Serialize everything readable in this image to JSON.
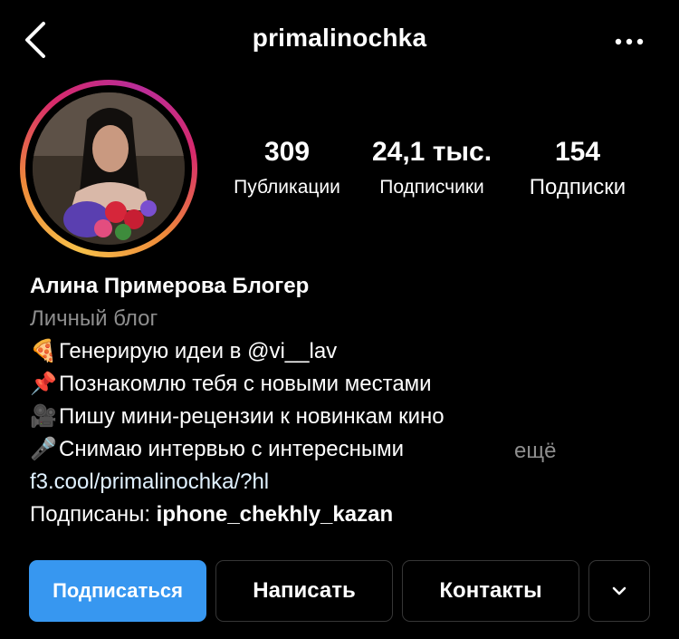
{
  "header": {
    "username": "primalinochka"
  },
  "profile": {
    "stats": [
      {
        "value": "309",
        "label": "Публикации"
      },
      {
        "value": "24,1 тыс.",
        "label": "Подписчики"
      },
      {
        "value": "154",
        "label": "Подписки"
      }
    ],
    "name": "Алина Примерова Блогер",
    "category": "Личный блог",
    "bio_lines": [
      {
        "emoji": "🍕",
        "text": "Генерирую идеи в @vi__lav"
      },
      {
        "emoji": "📌",
        "text": "Познакомлю тебя с новыми местами"
      },
      {
        "emoji": "🎥",
        "text": "Пишу мини-рецензии к новинкам кино"
      },
      {
        "emoji": "🎤",
        "text": "Снимаю интервью с интересными"
      }
    ],
    "more_label": "ещё",
    "link": "f3.cool/primalinochka/?hl",
    "followed_by_label": "Подписаны:",
    "followed_by_user": "iphone_chekhly_kazan"
  },
  "actions": {
    "follow": "Подписаться",
    "message": "Написать",
    "contacts": "Контакты"
  },
  "colors": {
    "background": "#000000",
    "primary_button": "#3797f0",
    "secondary_text": "#8e8e8e",
    "ring_gradient": [
      "#f7c04a",
      "#d72a6b",
      "#b92d9a"
    ]
  },
  "icons": {
    "back": "chevron-left-icon",
    "more": "more-horizontal-icon",
    "dropdown": "chevron-down-icon"
  }
}
